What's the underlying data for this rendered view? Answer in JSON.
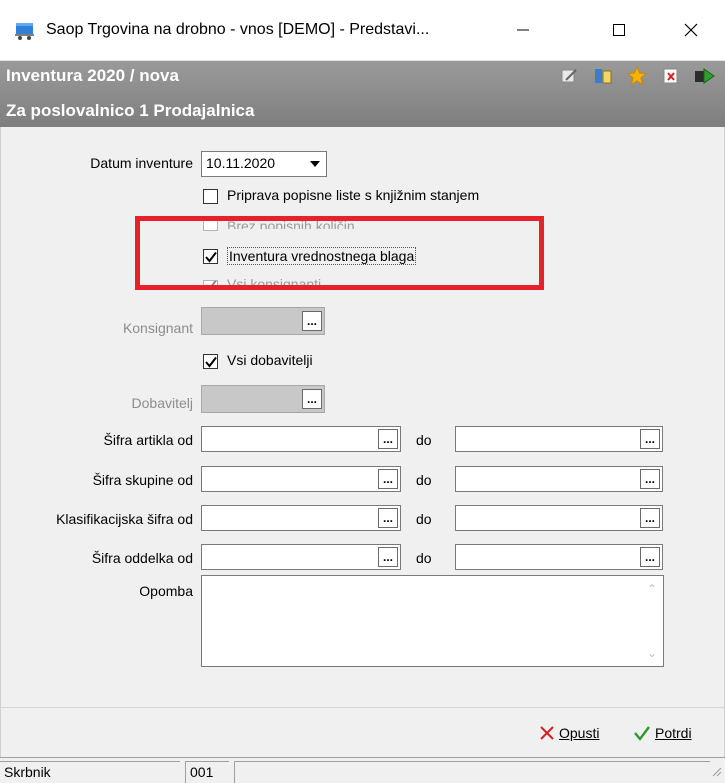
{
  "window": {
    "title": "Saop Trgovina na drobno - vnos [DEMO] - Predstavi...",
    "minimize_icon": "minimize-icon",
    "maximize_icon": "maximize-icon",
    "close_icon": "close-icon"
  },
  "header": {
    "line1": "Inventura 2020 / nova",
    "line2": "Za poslovalnico 1 Prodajalnica",
    "icons": [
      "edit-icon",
      "table-icon",
      "star-icon",
      "delete-icon",
      "exit-icon"
    ]
  },
  "form": {
    "datum_label": "Datum inventure",
    "datum_value": "10.11.2020",
    "checkboxes": [
      {
        "label": "Priprava popisne liste s knjižnim stanjem",
        "checked": false,
        "enabled": true
      },
      {
        "label": "Brez popisnih količin",
        "checked": false,
        "enabled": false
      },
      {
        "label": "Inventura vrednostnega blaga",
        "checked": true,
        "enabled": true
      },
      {
        "label": "Vsi konsignanti",
        "checked": true,
        "enabled": false
      }
    ],
    "konsignant_label": "Konsignant",
    "vsi_dobavitelji_label": "Vsi dobavitelji",
    "vsi_dobavitelji_checked": true,
    "dobavitelj_label": "Dobavitelj",
    "range_rows": [
      {
        "label": "Šifra artikla od",
        "to_label": "do",
        "from_value": "",
        "to_value": ""
      },
      {
        "label": "Šifra skupine od",
        "to_label": "do",
        "from_value": "",
        "to_value": ""
      },
      {
        "label": "Klasifikacijska šifra od",
        "to_label": "do",
        "from_value": "",
        "to_value": ""
      },
      {
        "label": "Šifra oddelka od",
        "to_label": "do",
        "from_value": "",
        "to_value": ""
      }
    ],
    "opomba_label": "Opomba",
    "opomba_value": "",
    "ellipsis": "..."
  },
  "actions": {
    "cancel_label": "Opusti",
    "confirm_label": "Potrdi"
  },
  "statusbar": {
    "user": "Skrbnik",
    "code": "001"
  },
  "colors": {
    "highlight": "#e8202a",
    "header_band": "#8a8a8a"
  }
}
